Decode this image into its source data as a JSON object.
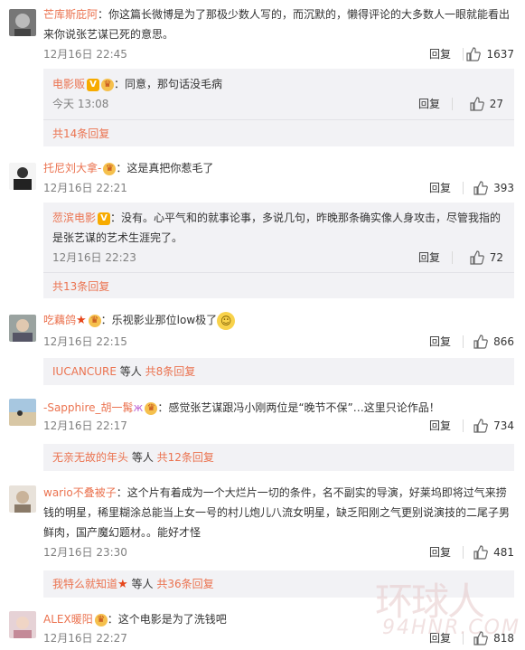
{
  "like_icon": "thumb-up-icon",
  "comments": [
    {
      "user": "芒库斯庇阿",
      "text": "：你这篇长微博是为了那极少数人写的，而沉默的，懒得评论的大多数人一眼就能看出来你说张艺谋已死的意思。",
      "time": "12月16日 22:45",
      "reply": "回复",
      "likes": "1637",
      "sub": {
        "user": "电影贩",
        "text": "：同意，那句话没毛病",
        "time": "今天 13:08",
        "reply": "回复",
        "likes": "27",
        "more": "共14条回复"
      }
    },
    {
      "user": "托尼刘大拿-",
      "text": "：这是真把你惹毛了",
      "time": "12月16日 22:21",
      "reply": "回复",
      "likes": "393",
      "sub": {
        "user": "䓤滨电影",
        "text": "：没有。心平气和的就事论事，多说几句，昨晚那条确实像人身攻击，尽管我指的是张艺谋的艺术生涯完了。",
        "time": "12月16日 22:23",
        "reply": "回复",
        "likes": "72",
        "more": "共13条回复"
      }
    },
    {
      "user": "吃藕鸽",
      "text": "：乐视影业那位low极了",
      "time": "12月16日 22:15",
      "reply": "回复",
      "likes": "866",
      "more_user": "IUCANCURE",
      "more_mid": " 等人 ",
      "more_count": "共8条回复"
    },
    {
      "user": "-Sapphire_胡一髯",
      "text": "：感觉张艺谋跟冯小刚两位是“晚节不保”…这里只论作品！",
      "time": "12月16日 22:17",
      "reply": "回复",
      "likes": "734",
      "more_user": "无亲无故的年头",
      "more_mid": " 等人 ",
      "more_count": "共12条回复"
    },
    {
      "user": "wario不叠被子",
      "text": "：这个片有着成为一个大烂片一切的条件，名不副实的导演，好莱坞即将过气来捞钱的明星，稀里糊涂总能当上女一号的村儿炮儿八流女明星，缺乏阳刚之气更别说演技的二尾子男鲜肉，国产魔幻题材。。能好才怪",
      "time": "12月16日 23:30",
      "reply": "回复",
      "likes": "481",
      "more_user": "我特么就知道",
      "more_mid": " 等人 ",
      "more_count": "共36条回复"
    },
    {
      "user": "ALEX暖阳",
      "text": "：这个电影是为了洗钱吧",
      "time": "12月16日 22:27",
      "reply": "回复",
      "likes": "818"
    }
  ],
  "watermark": {
    "cn": "环球人",
    "en": "94HNR.COM"
  }
}
